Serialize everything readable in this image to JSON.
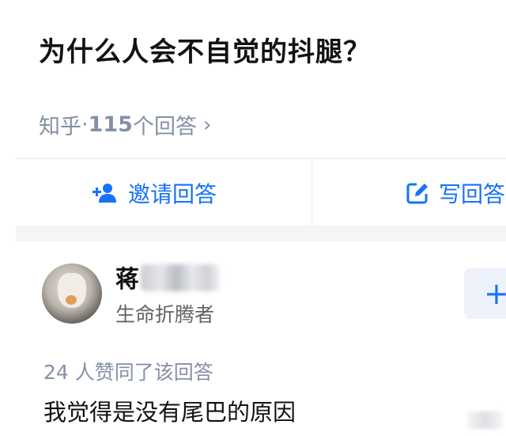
{
  "question": {
    "title": "为什么人会不自觉的抖腿？",
    "source": "知乎",
    "separator": " · ",
    "answer_count": "115",
    "answer_count_suffix": " 个回答",
    "chevron_icon": "chevron-right-icon"
  },
  "actions": {
    "invite_label": "邀请回答",
    "invite_icon": "add-user-icon",
    "write_label": "写回答",
    "write_icon": "edit-icon"
  },
  "answer": {
    "author_name": "蒋",
    "author_bio": "生命折腾者",
    "follow_label": "+",
    "votes_text": "24 人赞同了该回答",
    "content": "我觉得是没有尾巴的原因"
  },
  "colors": {
    "accent": "#1772f6",
    "muted": "#8590a6",
    "title": "#121212"
  }
}
